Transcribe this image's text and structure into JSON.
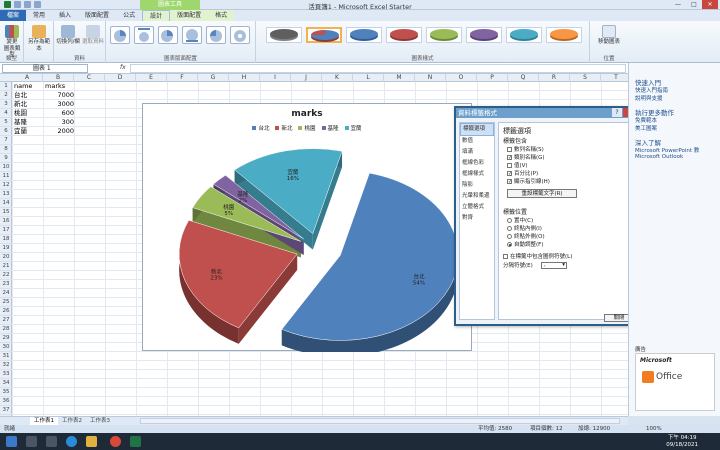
{
  "window": {
    "title": "活頁簿1 - Microsoft Excel Starter",
    "context_tab": "圖表工具",
    "min": "—",
    "max": "□",
    "close": "✕"
  },
  "tabs": [
    "檔案",
    "常用",
    "插入",
    "版面配置",
    "公式",
    "設計",
    "版面配置",
    "格式"
  ],
  "ribbon": {
    "change_type": "變更\n圖表類型",
    "save_template": "另存為範本",
    "switch_rowcol": "切換列/欄",
    "select_data": "選取資料",
    "move_chart": "移動圖表",
    "group_type": "類型",
    "group_data": "資料",
    "group_layout": "圖表版面配置",
    "group_styles": "圖表樣式",
    "group_location": "位置"
  },
  "formula_bar": {
    "name_box": "圖表 1",
    "fx": "fx",
    "formula": ""
  },
  "columns": [
    "A",
    "B",
    "C",
    "D",
    "E",
    "F",
    "G",
    "H",
    "I",
    "J",
    "K",
    "L",
    "M",
    "N",
    "O",
    "P",
    "Q",
    "R",
    "S",
    "T"
  ],
  "rows": [
    "1",
    "2",
    "3",
    "4",
    "5",
    "6",
    "7",
    "8",
    "9",
    "10",
    "11",
    "12",
    "13",
    "14",
    "15",
    "16",
    "17",
    "18",
    "19",
    "20",
    "21",
    "22",
    "23",
    "24",
    "25",
    "26",
    "27",
    "28",
    "29",
    "30",
    "31",
    "32",
    "33",
    "34",
    "35",
    "36",
    "37"
  ],
  "sheet": {
    "header": [
      "name",
      "marks"
    ],
    "data": [
      [
        "台北",
        "7000"
      ],
      [
        "新北",
        "3000"
      ],
      [
        "桃園",
        "600"
      ],
      [
        "基隆",
        "300"
      ],
      [
        "宜蘭",
        "2000"
      ]
    ]
  },
  "chart_data": {
    "type": "pie",
    "title": "marks",
    "categories": [
      "台北",
      "新北",
      "桃園",
      "基隆",
      "宜蘭"
    ],
    "values": [
      7000,
      3000,
      600,
      300,
      2000
    ],
    "percent_labels": [
      "54%",
      "23%",
      "5%",
      "2%",
      "16%"
    ],
    "colors": [
      "#4f81bd",
      "#c0504d",
      "#9bbb59",
      "#8064a2",
      "#4bacc6"
    ],
    "legend": "top",
    "exploded": true,
    "three_d": true
  },
  "dialog": {
    "title": "資料標籤格式",
    "help": "?",
    "close": "✕",
    "nav": [
      "標籤選項",
      "數值",
      "填滿",
      "框線色彩",
      "框線樣式",
      "陰影",
      "光暈和柔邊",
      "立體格式",
      "對齊"
    ],
    "heading": "標籤選項",
    "contains_label": "標籤包含",
    "checks": [
      {
        "label": "數列名稱(S)",
        "checked": false
      },
      {
        "label": "類別名稱(G)",
        "checked": true
      },
      {
        "label": "值(V)",
        "checked": false
      },
      {
        "label": "百分比(P)",
        "checked": true
      },
      {
        "label": "顯示指引線(H)",
        "checked": true
      }
    ],
    "reset_btn": "重設標籤文字(R)",
    "position_label": "標籤位置",
    "positions": [
      {
        "label": "置中(C)",
        "on": false
      },
      {
        "label": "終點內側(I)",
        "on": false
      },
      {
        "label": "終點外側(O)",
        "on": false
      },
      {
        "label": "自動調整(F)",
        "on": true
      }
    ],
    "legend_key": "在標籤中包含圖例符號(L)",
    "separator_label": "分隔符號(E)",
    "separator_value": ",",
    "close_btn": "關閉"
  },
  "pane": {
    "quick_start": "快速入門",
    "links1": [
      "快速入門指南",
      "說明與支援"
    ],
    "do_more": "執行更多動作",
    "links2": [
      "免費範本",
      "美工圖案"
    ],
    "learn_more": "深入了解",
    "links3": [
      "Microsoft PowerPoint 教",
      "Microsoft Outlook"
    ],
    "ad_label": "廣告",
    "ad_brand": "Microsoft",
    "ad_product": "Office"
  },
  "sheet_tabs": [
    "工作表1",
    "工作表2",
    "工作表3"
  ],
  "status": {
    "ready": "就緒",
    "average": "平均值: 2580",
    "count": "項目個數: 12",
    "sum": "加總: 12900",
    "zoom": "100%"
  },
  "taskbar": {
    "time": "下午 04:19",
    "date": "09/18/2021"
  }
}
